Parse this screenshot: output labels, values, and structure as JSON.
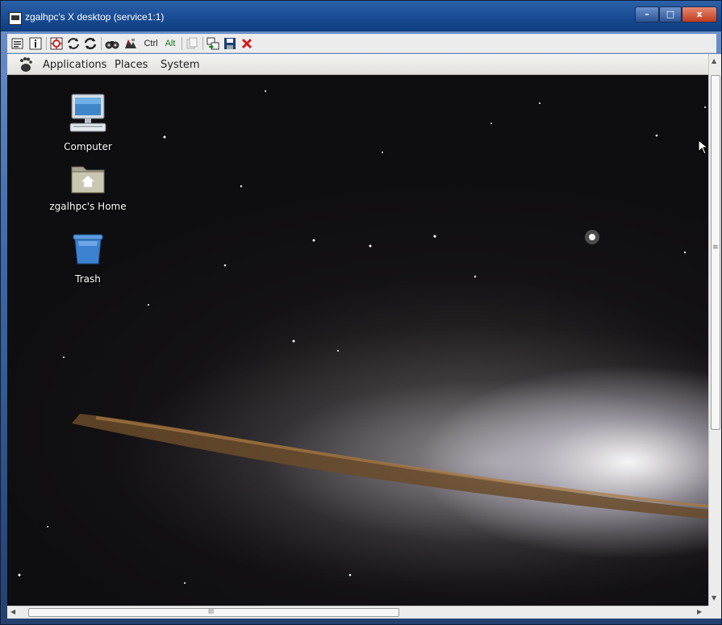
{
  "window": {
    "title": "zgalhpc's X desktop (service1:1)",
    "controls": {
      "minimize": "–",
      "maximize": "□",
      "close": "x"
    }
  },
  "toolbar": {
    "items": [
      "properties-icon",
      "info-icon",
      "fullscreen-icon",
      "refresh-icon",
      "refresh-all-icon",
      "binoculars-icon",
      "send-ctrl-alt-del-icon"
    ],
    "ctrl_label": "Ctrl",
    "alt_label": "Alt",
    "trailing": [
      "clipboard-icon",
      "transfer-icon",
      "save-icon",
      "disconnect-icon"
    ]
  },
  "panel": {
    "menus": {
      "applications": "Applications",
      "places": "Places",
      "system": "System"
    }
  },
  "desktop": {
    "icons": {
      "computer": "Computer",
      "home": "zgalhpc's Home",
      "trash": "Trash"
    }
  },
  "scrollbars": {
    "h_grip": "III",
    "v_grip": "≡"
  },
  "colors": {
    "titlebar": "#1b4f98",
    "close_button": "#c03a1c",
    "panel": "#e8e7e4"
  }
}
